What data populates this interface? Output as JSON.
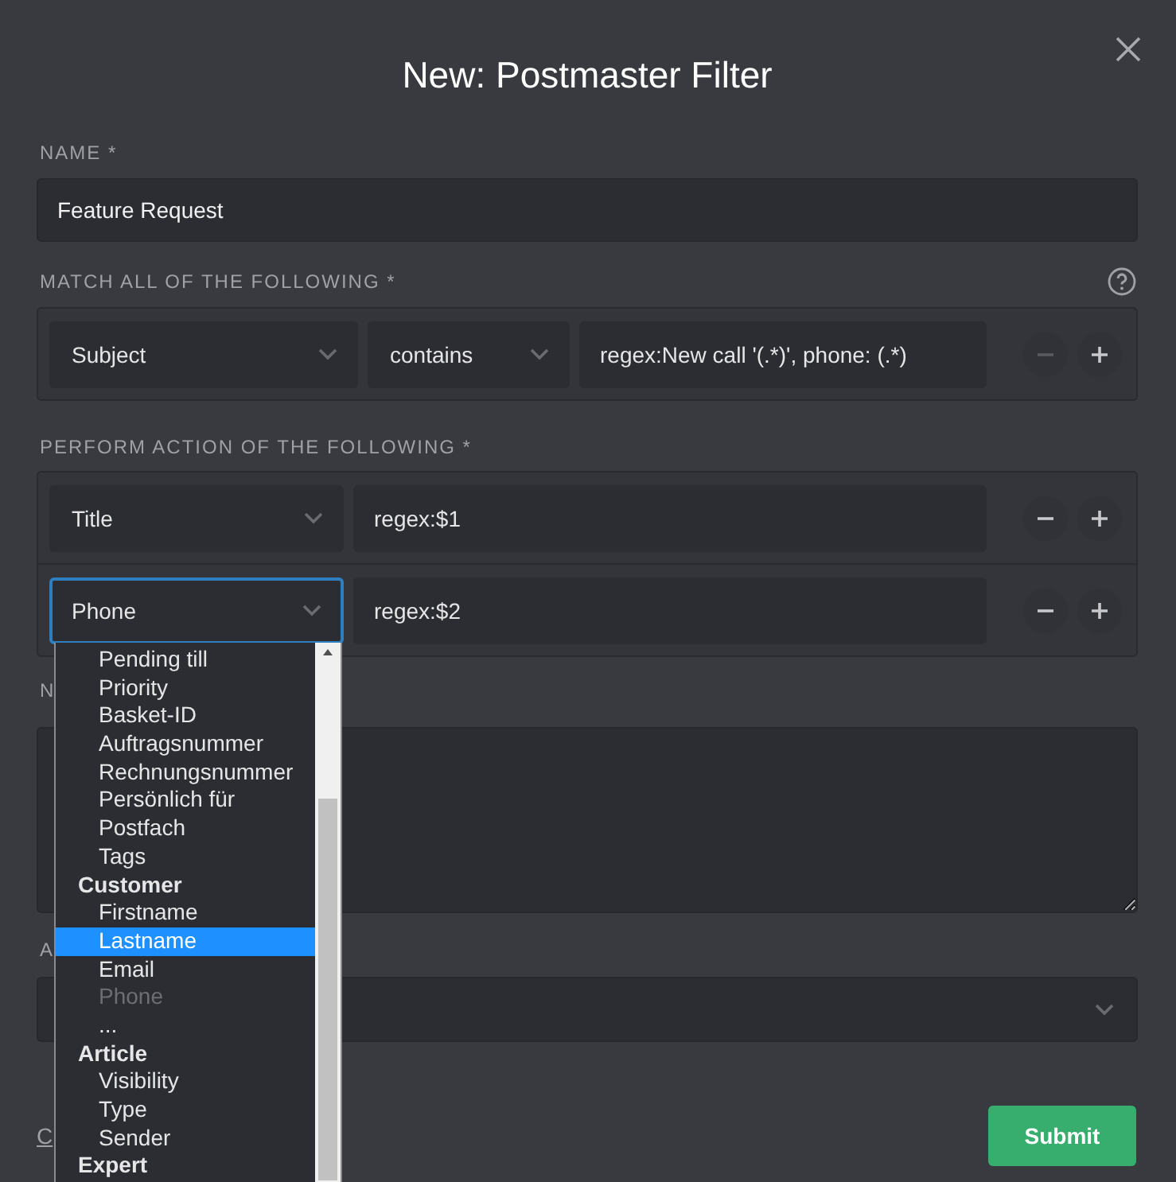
{
  "dialog": {
    "title": "New: Postmaster Filter"
  },
  "name_field": {
    "label": "NAME *",
    "value": "Feature Request"
  },
  "match": {
    "label": "MATCH ALL OF THE FOLLOWING *",
    "rows": [
      {
        "attribute": "Subject",
        "operator": "contains",
        "value": "regex:New call '(.*)', phone: (.*)",
        "remove_disabled": true
      }
    ]
  },
  "perform": {
    "label": "PERFORM ACTION OF THE FOLLOWING *",
    "rows": [
      {
        "attribute": "Title",
        "value": "regex:$1",
        "focused": false,
        "remove_disabled": false
      },
      {
        "attribute": "Phone",
        "value": "regex:$2",
        "focused": true,
        "remove_disabled": false
      }
    ]
  },
  "dropdown": {
    "items": [
      {
        "kind": "option",
        "label": "Pending till",
        "selected": false,
        "disabled": false
      },
      {
        "kind": "option",
        "label": "Priority",
        "selected": false,
        "disabled": false
      },
      {
        "kind": "option",
        "label": "Basket-ID",
        "selected": false,
        "disabled": false
      },
      {
        "kind": "option",
        "label": "Auftragsnummer",
        "selected": false,
        "disabled": false
      },
      {
        "kind": "option",
        "label": "Rechnungsnummer",
        "selected": false,
        "disabled": false
      },
      {
        "kind": "option",
        "label": "Persönlich für",
        "selected": false,
        "disabled": false
      },
      {
        "kind": "option",
        "label": "Postfach",
        "selected": false,
        "disabled": false
      },
      {
        "kind": "option",
        "label": "Tags",
        "selected": false,
        "disabled": false
      },
      {
        "kind": "group",
        "label": "Customer"
      },
      {
        "kind": "option",
        "label": "Firstname",
        "selected": false,
        "disabled": false
      },
      {
        "kind": "option",
        "label": "Lastname",
        "selected": true,
        "disabled": false
      },
      {
        "kind": "option",
        "label": "Email",
        "selected": false,
        "disabled": false
      },
      {
        "kind": "option",
        "label": "Phone",
        "selected": false,
        "disabled": true
      },
      {
        "kind": "option",
        "label": "...",
        "selected": false,
        "disabled": false
      },
      {
        "kind": "group",
        "label": "Article"
      },
      {
        "kind": "option",
        "label": "Visibility",
        "selected": false,
        "disabled": false
      },
      {
        "kind": "option",
        "label": "Type",
        "selected": false,
        "disabled": false
      },
      {
        "kind": "option",
        "label": "Sender",
        "selected": false,
        "disabled": false
      },
      {
        "kind": "group",
        "label": "Expert"
      }
    ]
  },
  "note_field": {
    "label": "N"
  },
  "group_field": {
    "label": "A"
  },
  "cancel_link": "C",
  "submit_button": "Submit"
}
